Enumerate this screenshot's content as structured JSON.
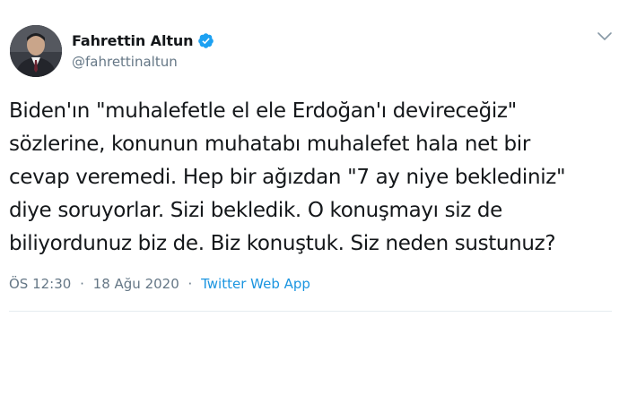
{
  "author": {
    "display_name": "Fahrettin Altun",
    "handle": "@fahrettinaltun",
    "verified": true,
    "avatar_icon": "profile-photo"
  },
  "tweet": {
    "lines": [
      "Biden'ın \"muhalefetle el ele Erdoğan'ı devireceğiz\"",
      "sözlerine, konunun muhatabı muhalefet hala net bir",
      "cevap veremedi. Hep bir ağızdan \"7 ay niye beklediniz\"",
      "diye soruyorlar. Sizi bekledik. O konuşmayı siz de",
      "biliyordunuz biz de. Biz konuştuk. Siz neden sustunuz?"
    ]
  },
  "meta": {
    "time": "ÖS 12:30",
    "separator": "·",
    "date": "18 Ağu 2020",
    "source": "Twitter Web App"
  },
  "colors": {
    "text": "#14171a",
    "secondary": "#657786",
    "link": "#1b95e0",
    "verified": "#1da1f2",
    "divider": "#e6ecf0"
  },
  "icons": {
    "verified": "verified-badge-icon",
    "menu": "chevron-down-icon"
  }
}
